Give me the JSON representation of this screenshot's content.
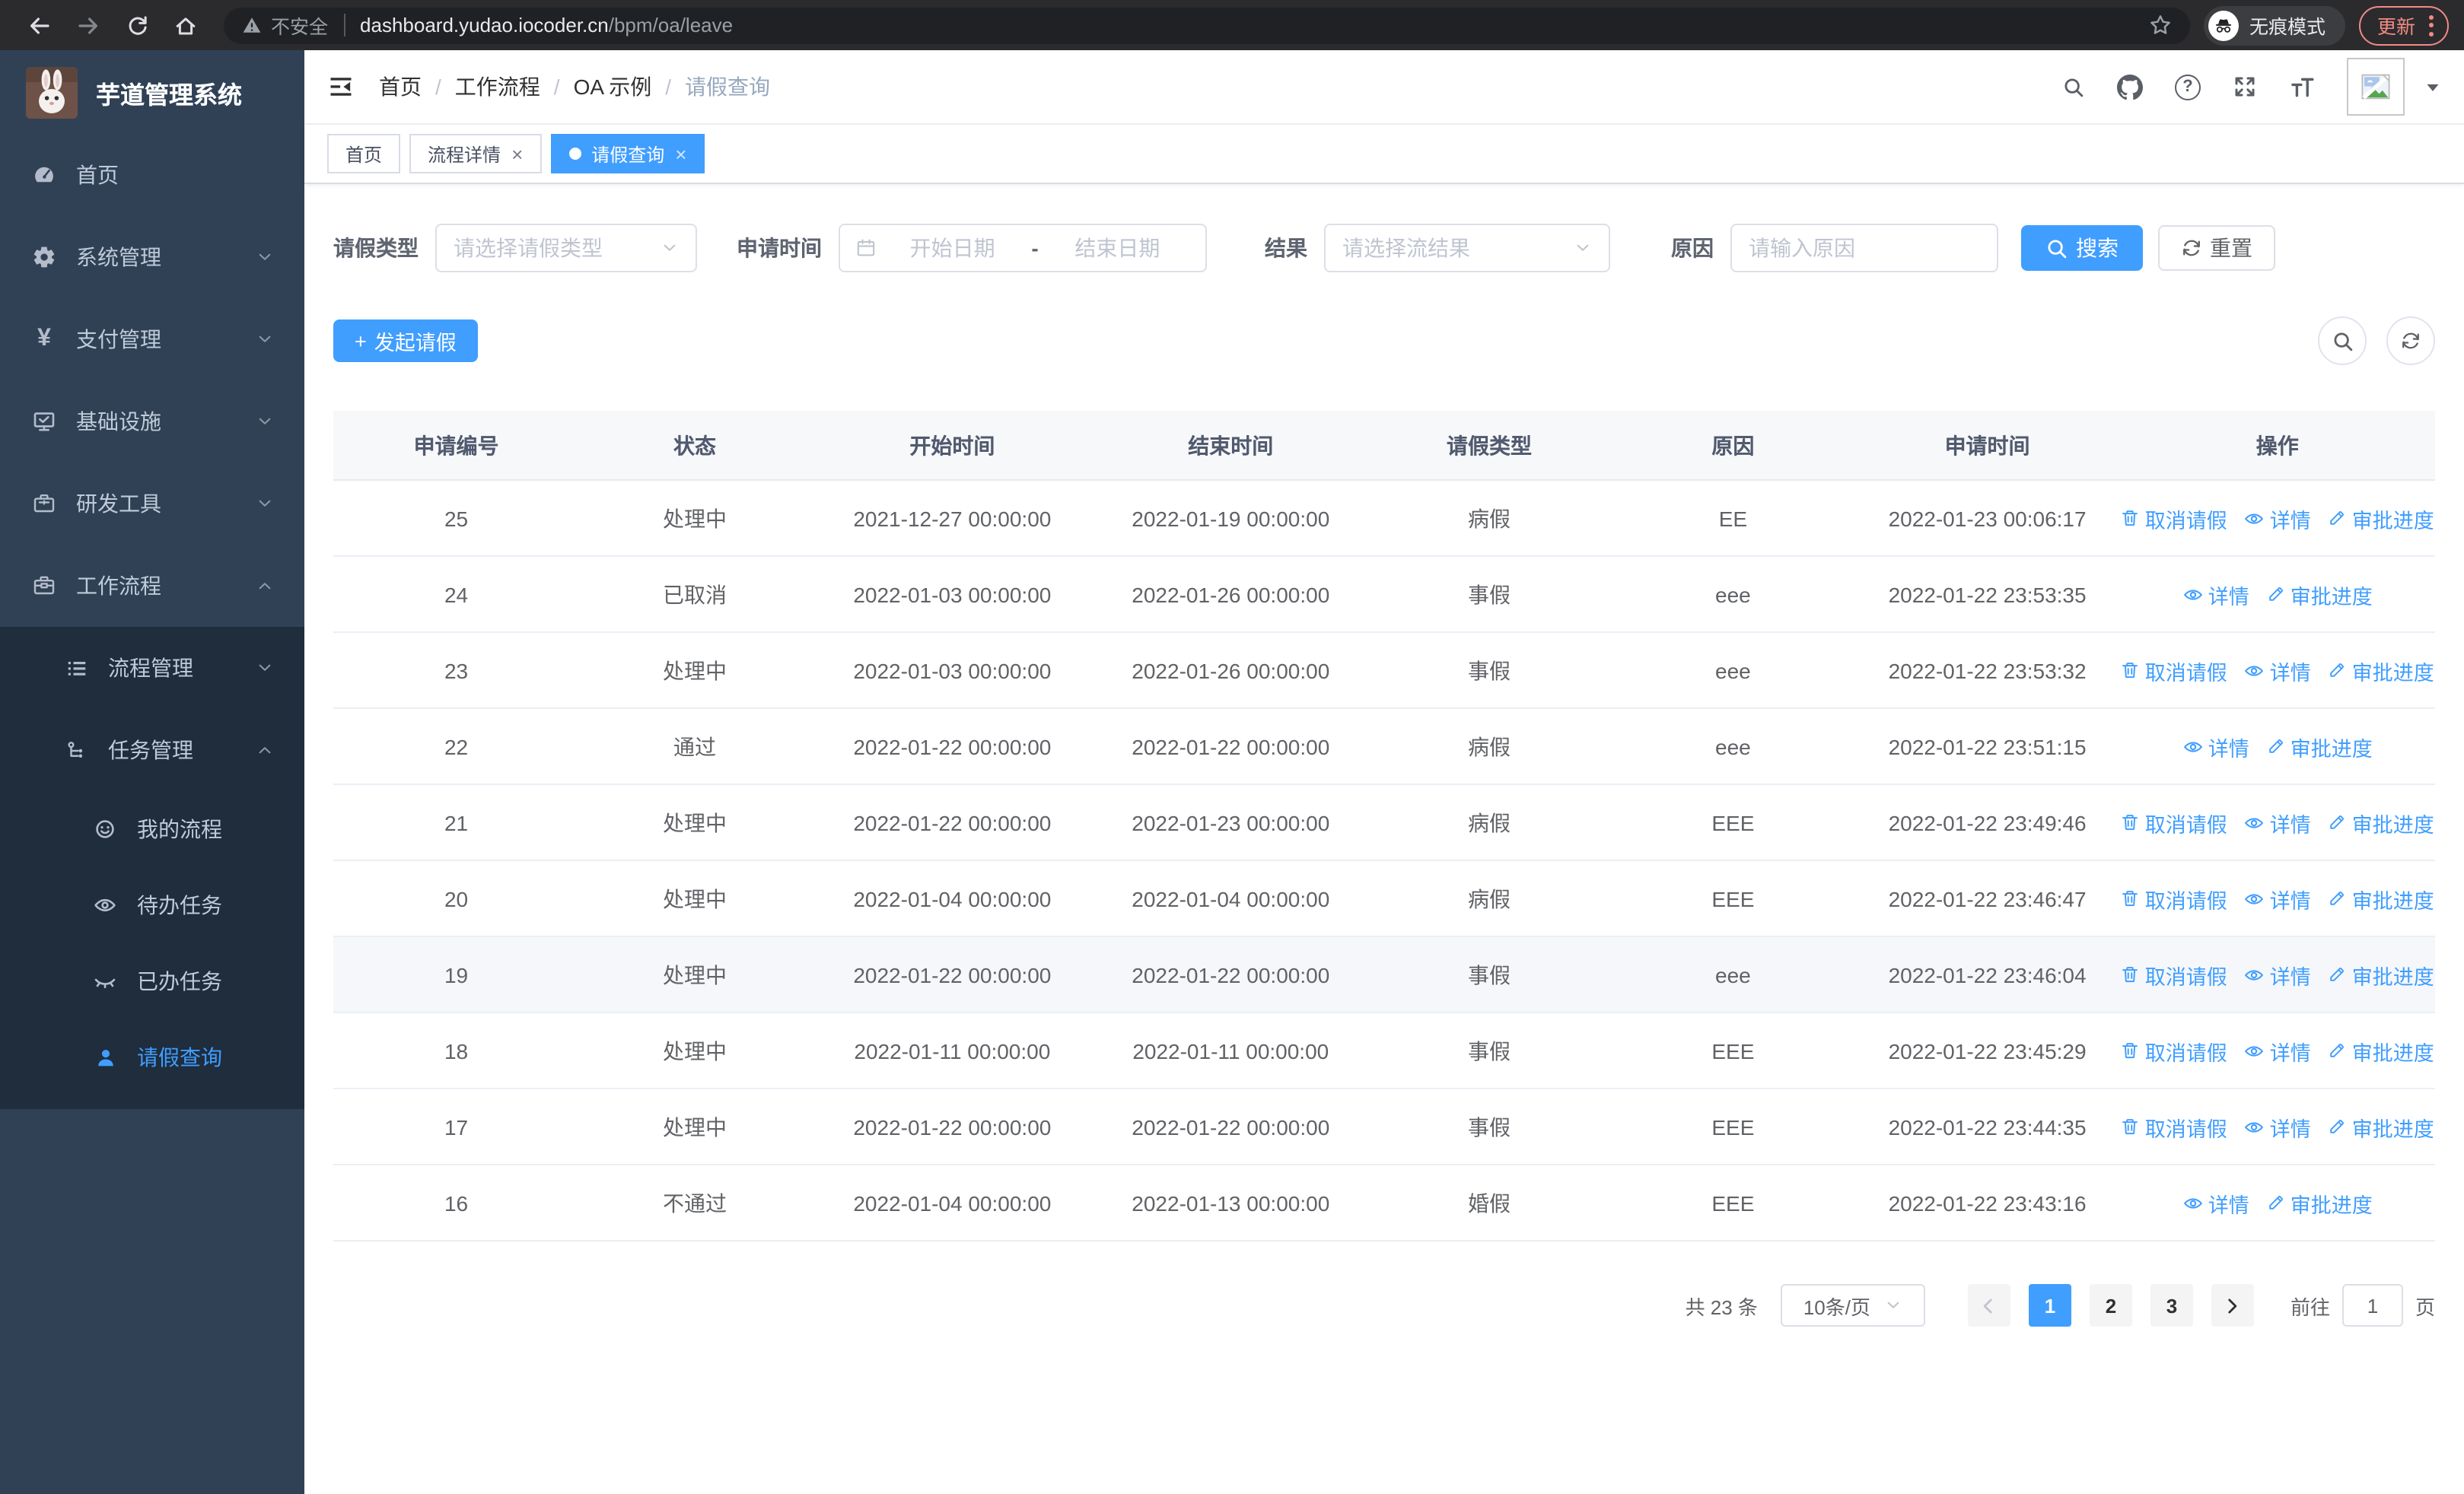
{
  "accent_color": "#409eff",
  "sidebar_bg": "#304156",
  "submenu_bg": "#1f2d3d",
  "update_color": "#f28b82",
  "browser": {
    "security_label": "不安全",
    "url_domain": "dashboard.yudao.iocoder.cn",
    "url_path": "/bpm/oa/leave",
    "incognito_label": "无痕模式",
    "update_label": "更新",
    "icons": [
      "back-icon",
      "forward-icon",
      "reload-icon",
      "home-icon",
      "warning-icon",
      "star-icon",
      "incognito-icon",
      "more-vert-icon"
    ]
  },
  "sidebar": {
    "title": "芋道管理系统",
    "logo_icon": "rabbit-logo",
    "menu": [
      {
        "icon": "dashboard-icon",
        "label": "首页",
        "level": 1
      },
      {
        "icon": "gear-icon",
        "label": "系统管理",
        "level": 1,
        "chevron": "down"
      },
      {
        "icon": "yen-icon",
        "label": "支付管理",
        "level": 1,
        "chevron": "down"
      },
      {
        "icon": "monitor-icon",
        "label": "基础设施",
        "level": 1,
        "chevron": "down"
      },
      {
        "icon": "toolbox-icon",
        "label": "研发工具",
        "level": 1,
        "chevron": "down"
      },
      {
        "icon": "suitcase-icon",
        "label": "工作流程",
        "level": 1,
        "chevron": "up"
      },
      {
        "icon": "tree-list-icon",
        "label": "流程管理",
        "level": 2,
        "chevron": "down",
        "dark": true
      },
      {
        "icon": "flow-icon",
        "label": "任务管理",
        "level": 2,
        "chevron": "up",
        "dark": true
      },
      {
        "icon": "face-icon",
        "label": "我的流程",
        "level": 3,
        "dark": true
      },
      {
        "icon": "eye-open-icon",
        "label": "待办任务",
        "level": 3,
        "dark": true
      },
      {
        "icon": "eye-closed-icon",
        "label": "已办任务",
        "level": 3,
        "dark": true
      },
      {
        "icon": "person-icon",
        "label": "请假查询",
        "level": 3,
        "dark": true,
        "active": true
      }
    ]
  },
  "header": {
    "breadcrumb": [
      "首页",
      "工作流程",
      "OA 示例",
      "请假查询"
    ],
    "icons": [
      "search-icon",
      "github-icon",
      "question-icon",
      "fullscreen-icon",
      "fontsize-icon"
    ],
    "avatar_icon": "image-placeholder-icon"
  },
  "tabs": [
    {
      "label": "首页"
    },
    {
      "label": "流程详情",
      "closable": true
    },
    {
      "label": "请假查询",
      "closable": true,
      "active": true
    }
  ],
  "filters": {
    "type_label": "请假类型",
    "type_placeholder": "请选择请假类型",
    "time_label": "申请时间",
    "date_start_placeholder": "开始日期",
    "date_separator": "-",
    "date_end_placeholder": "结束日期",
    "result_label": "结果",
    "result_placeholder": "请选择流结果",
    "reason_label": "原因",
    "reason_placeholder": "请输入原因",
    "search_label": "搜索",
    "reset_label": "重置"
  },
  "toolbar": {
    "create_label": "发起请假",
    "round_icons": [
      "search-icon",
      "refresh-icon"
    ]
  },
  "table": {
    "columns": [
      "申请编号",
      "状态",
      "开始时间",
      "结束时间",
      "请假类型",
      "原因",
      "申请时间",
      "操作"
    ],
    "col_widths": [
      11.7,
      11,
      13.5,
      13,
      11.6,
      11.6,
      12.6,
      15
    ],
    "action_labels": {
      "cancel": "取消请假",
      "detail": "详情",
      "progress": "审批进度"
    },
    "action_icons": {
      "cancel": "delete-icon",
      "detail": "view-icon",
      "progress": "edit-icon"
    },
    "rows": [
      {
        "id": "25",
        "status": "处理中",
        "start": "2021-12-27 00:00:00",
        "end": "2022-01-19 00:00:00",
        "type": "病假",
        "reason": "EE",
        "applied": "2022-01-23 00:06:17",
        "actions": [
          "cancel",
          "detail",
          "progress"
        ]
      },
      {
        "id": "24",
        "status": "已取消",
        "start": "2022-01-03 00:00:00",
        "end": "2022-01-26 00:00:00",
        "type": "事假",
        "reason": "eee",
        "applied": "2022-01-22 23:53:35",
        "actions": [
          "detail",
          "progress"
        ]
      },
      {
        "id": "23",
        "status": "处理中",
        "start": "2022-01-03 00:00:00",
        "end": "2022-01-26 00:00:00",
        "type": "事假",
        "reason": "eee",
        "applied": "2022-01-22 23:53:32",
        "actions": [
          "cancel",
          "detail",
          "progress"
        ]
      },
      {
        "id": "22",
        "status": "通过",
        "start": "2022-01-22 00:00:00",
        "end": "2022-01-22 00:00:00",
        "type": "病假",
        "reason": "eee",
        "applied": "2022-01-22 23:51:15",
        "actions": [
          "detail",
          "progress"
        ]
      },
      {
        "id": "21",
        "status": "处理中",
        "start": "2022-01-22 00:00:00",
        "end": "2022-01-23 00:00:00",
        "type": "病假",
        "reason": "EEE",
        "applied": "2022-01-22 23:49:46",
        "actions": [
          "cancel",
          "detail",
          "progress"
        ]
      },
      {
        "id": "20",
        "status": "处理中",
        "start": "2022-01-04 00:00:00",
        "end": "2022-01-04 00:00:00",
        "type": "病假",
        "reason": "EEE",
        "applied": "2022-01-22 23:46:47",
        "actions": [
          "cancel",
          "detail",
          "progress"
        ]
      },
      {
        "id": "19",
        "status": "处理中",
        "start": "2022-01-22 00:00:00",
        "end": "2022-01-22 00:00:00",
        "type": "事假",
        "reason": "eee",
        "applied": "2022-01-22 23:46:04",
        "actions": [
          "cancel",
          "detail",
          "progress"
        ],
        "highlight": true
      },
      {
        "id": "18",
        "status": "处理中",
        "start": "2022-01-11 00:00:00",
        "end": "2022-01-11 00:00:00",
        "type": "事假",
        "reason": "EEE",
        "applied": "2022-01-22 23:45:29",
        "actions": [
          "cancel",
          "detail",
          "progress"
        ]
      },
      {
        "id": "17",
        "status": "处理中",
        "start": "2022-01-22 00:00:00",
        "end": "2022-01-22 00:00:00",
        "type": "事假",
        "reason": "EEE",
        "applied": "2022-01-22 23:44:35",
        "actions": [
          "cancel",
          "detail",
          "progress"
        ]
      },
      {
        "id": "16",
        "status": "不通过",
        "start": "2022-01-04 00:00:00",
        "end": "2022-01-13 00:00:00",
        "type": "婚假",
        "reason": "EEE",
        "applied": "2022-01-22 23:43:16",
        "actions": [
          "detail",
          "progress"
        ]
      }
    ]
  },
  "pagination": {
    "total_label": "共 23 条",
    "page_size_label": "10条/页",
    "pages": [
      "1",
      "2",
      "3"
    ],
    "active_page": "1",
    "goto_label": "前往",
    "goto_value": "1",
    "page_unit_label": "页"
  }
}
